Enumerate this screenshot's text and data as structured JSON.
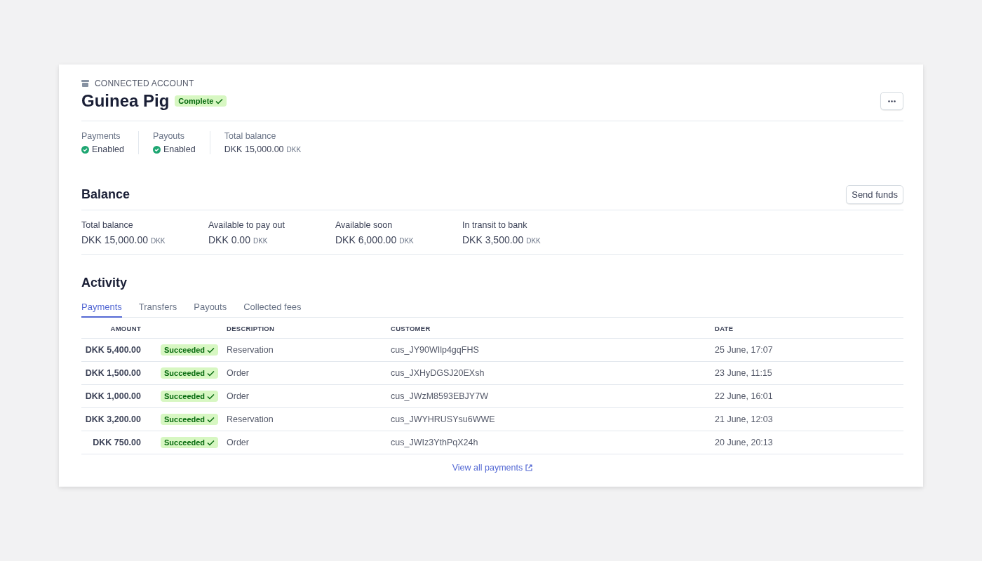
{
  "header": {
    "eyebrow": "CONNECTED ACCOUNT",
    "title": "Guinea Pig",
    "badge": "Complete"
  },
  "summary": [
    {
      "label": "Payments",
      "value": "Enabled",
      "kind": "status"
    },
    {
      "label": "Payouts",
      "value": "Enabled",
      "kind": "status"
    },
    {
      "label": "Total balance",
      "value": "DKK 15,000.00",
      "currency": "DKK",
      "kind": "amount"
    }
  ],
  "balance": {
    "title": "Balance",
    "button": "Send funds",
    "items": [
      {
        "label": "Total balance",
        "value": "DKK 15,000.00",
        "currency": "DKK"
      },
      {
        "label": "Available to pay out",
        "value": "DKK 0.00",
        "currency": "DKK"
      },
      {
        "label": "Available soon",
        "value": "DKK 6,000.00",
        "currency": "DKK"
      },
      {
        "label": "In transit to bank",
        "value": "DKK 3,500.00",
        "currency": "DKK"
      }
    ]
  },
  "activity": {
    "title": "Activity",
    "tabs": [
      {
        "label": "Payments",
        "selected": true
      },
      {
        "label": "Transfers",
        "selected": false
      },
      {
        "label": "Payouts",
        "selected": false
      },
      {
        "label": "Collected fees",
        "selected": false
      }
    ],
    "table": {
      "columns": [
        "AMOUNT",
        "DESCRIPTION",
        "CUSTOMER",
        "DATE"
      ],
      "rows": [
        {
          "amount": "DKK 5,400.00",
          "status": "Succeeded",
          "description": "Reservation",
          "customer": "cus_JY90WIlp4gqFHS",
          "date": "25 June, 17:07"
        },
        {
          "amount": "DKK 1,500.00",
          "status": "Succeeded",
          "description": "Order",
          "customer": "cus_JXHyDGSJ20EXsh",
          "date": "23 June, 11:15"
        },
        {
          "amount": "DKK 1,000.00",
          "status": "Succeeded",
          "description": "Order",
          "customer": "cus_JWzM8593EBJY7W",
          "date": "22 June, 16:01"
        },
        {
          "amount": "DKK 3,200.00",
          "status": "Succeeded",
          "description": "Reservation",
          "customer": "cus_JWYHRUSYsu6WWE",
          "date": "21 June, 12:03"
        },
        {
          "amount": "DKK 750.00",
          "status": "Succeeded",
          "description": "Order",
          "customer": "cus_JWIz3YthPqX24h",
          "date": "20 June, 20:13"
        }
      ]
    },
    "link": "View all payments"
  }
}
